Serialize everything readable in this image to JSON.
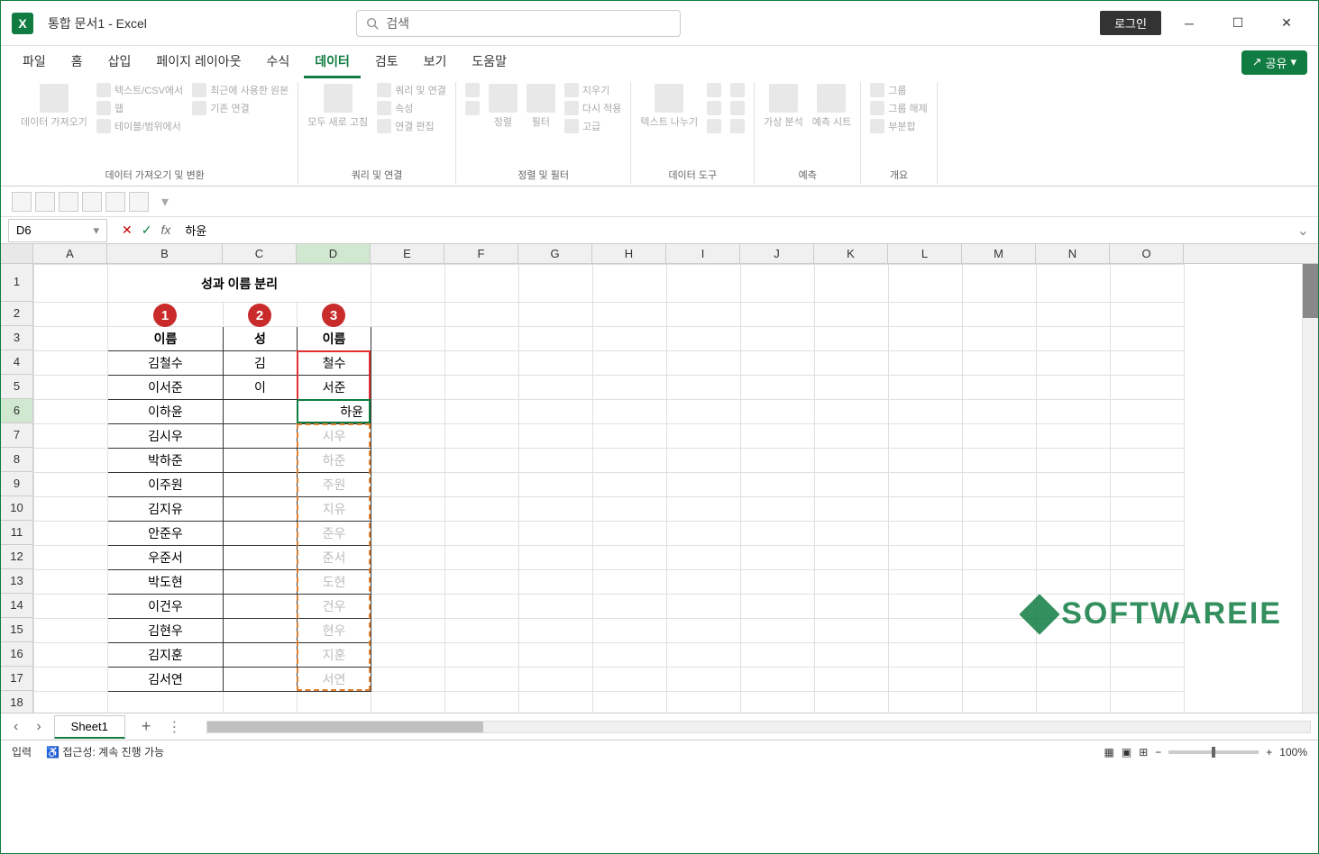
{
  "title": {
    "doc": "통합 문서1  -  Excel",
    "search_ph": "검색",
    "login": "로그인"
  },
  "tabs": {
    "file": "파일",
    "home": "홈",
    "insert": "삽입",
    "layout": "페이지 레이아웃",
    "formula": "수식",
    "data": "데이터",
    "review": "검토",
    "view": "보기",
    "help": "도움말",
    "share": "공유"
  },
  "ribbon": {
    "g1": {
      "label": "데이터 가져오기 및 변환",
      "items": [
        "데이터\n가져오기",
        "텍스트/CSV에서",
        "웹",
        "테이블/범위에서",
        "최근에 사용한 원본",
        "기존 연결"
      ]
    },
    "g2": {
      "label": "쿼리 및 연결",
      "items": [
        "모두 새로\n고침",
        "쿼리 및 연결",
        "속성",
        "연결 편집"
      ]
    },
    "g3": {
      "label": "정렬 및 필터",
      "items": [
        "정렬",
        "필터",
        "지우기",
        "다시 적용",
        "고급"
      ]
    },
    "g4": {
      "label": "데이터 도구",
      "items": [
        "텍스트\n나누기"
      ]
    },
    "g5": {
      "label": "예측",
      "items": [
        "가상\n분석",
        "예측\n시트"
      ]
    },
    "g6": {
      "label": "개요",
      "items": [
        "그룹",
        "그룹 해제",
        "부분합"
      ]
    }
  },
  "namebox": "D6",
  "formula": "하윤",
  "cols": [
    "A",
    "B",
    "C",
    "D",
    "E",
    "F",
    "G",
    "H",
    "I",
    "J",
    "K",
    "L",
    "M",
    "N",
    "O"
  ],
  "rows_header": [
    "1",
    "2",
    "3",
    "4",
    "5",
    "6",
    "7",
    "8",
    "9",
    "10",
    "11",
    "12",
    "13",
    "14",
    "15",
    "16",
    "17",
    "18"
  ],
  "cell_title": "성과 이름 분리",
  "markers": [
    "1",
    "2",
    "3"
  ],
  "headers": [
    "이름",
    "성",
    "이름"
  ],
  "data": {
    "b": [
      "김철수",
      "이서준",
      "이하윤",
      "김시우",
      "박하준",
      "이주원",
      "김지유",
      "안준우",
      "우준서",
      "박도현",
      "이건우",
      "김현우",
      "김지훈",
      "김서연"
    ],
    "c": [
      "김",
      "이",
      "",
      "",
      "",
      "",
      "",
      "",
      "",
      "",
      "",
      "",
      "",
      ""
    ],
    "d": [
      "철수",
      "서준",
      "하윤",
      "시우",
      "하준",
      "주원",
      "지유",
      "준우",
      "준서",
      "도현",
      "건우",
      "현우",
      "지훈",
      "서연"
    ]
  },
  "ghost_from_row": 4,
  "sheet": "Sheet1",
  "status": {
    "mode": "입력",
    "acc": "접근성: 계속 진행 가능",
    "zoom": "100%"
  },
  "watermark": "SOFTWAREIE",
  "chart_data": null
}
